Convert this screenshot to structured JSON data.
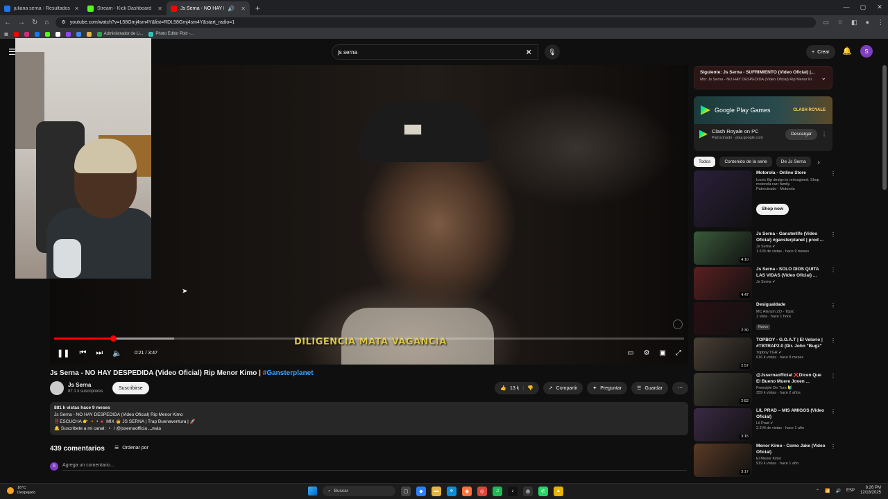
{
  "browser": {
    "tabs": [
      {
        "title": "juliana serna - Resultados de b",
        "favicon_color": "#1877f2",
        "active": false
      },
      {
        "title": "Stream - Kick Dashboard",
        "favicon_color": "#53fc18",
        "active": false
      },
      {
        "title": "Js Serna - NO HAY DESPEDI",
        "favicon_color": "#ff0000",
        "active": true
      }
    ],
    "url": "youtube.com/watch?v=L58Gmj4sm4Y&list=RDL58Gmj4sm4Y&start_radio=1",
    "bookmarks": [
      "Administrador de Li...",
      "Photo Editor Pixlr -..."
    ]
  },
  "yt_header": {
    "search_value": "js serna",
    "create_label": "Crear",
    "avatar_letter": "S"
  },
  "player": {
    "subtitle": "DILIGENCIA MATA VAGANCIA",
    "time": "0:21 / 3:47",
    "progress_fraction": 0.094,
    "buffered_fraction": 0.19
  },
  "video": {
    "title": "Js Serna - NO HAY DESPEDIDA (Video Oficial) Rip Menor Kimo | ",
    "hashtag": "#Gansterplanet",
    "channel": "Js Serna",
    "subscribers": "87.1 k suscriptores",
    "subscribe_label": "Suscribirse",
    "likes": "13 k",
    "share_label": "Compartir",
    "ask_label": "Preguntar",
    "save_label": "Guardar",
    "desc_meta": "881 k vistas  hace 9 meses",
    "desc_line1": "Js Serna - NO HAY DESPEDIDA (Video Oficial) Rip Menor Kimo",
    "desc_line2": "‼️ESCUCHA 👉 🔸 • 🔺 MIX 👨 JS SERNA | Trap Buenaventura | 🚀",
    "desc_line3": "🔔 Suscríbete a mi canal: 🔸 / @jssernaofficia",
    "desc_more": "...más",
    "comments_count": "439 comentarios",
    "sort_label": "Ordenar por",
    "comment_placeholder": "Agrega un comentario..."
  },
  "sidebar": {
    "upnext_title": "Siguiente: Js Serna - SUFRIMIENTO (Video Oficial) |...",
    "upnext_sub": "Mix: Js Serna - NO HAY DESPEDIDA (Video Oficial) Rip Menor Ki",
    "ad": {
      "banner_text": "Google Play Games",
      "banner_brand": "CLASH ROYALE",
      "name": "Clash Royale on PC",
      "sponsor": "Patrocinado · play.google.com",
      "download_label": "Descargar"
    },
    "chips": [
      "Todos",
      "Contenido de la serie",
      "De Js Serna"
    ],
    "recs": [
      {
        "title": "Motorola - Online Store",
        "channel": "Iconic flip design is reimagined. Shop motorola razr family.",
        "meta": "Patrocinado · Motorola",
        "duration": "",
        "badge": "",
        "cta": "Shop now",
        "thumb": "#2a1f3a"
      },
      {
        "title": "Js Serna - Gansterlife (Video Oficial) #gansterplanet | prod ...",
        "channel": "Js Serna ✔",
        "meta": "1.6 M de vistas · hace 9 meses",
        "duration": "4:10",
        "badge": "",
        "cta": "",
        "thumb": "#3a5a3a"
      },
      {
        "title": "Js Serna - SOLO DIOS QUITA LAS VIDAS (Video Oficial) ...",
        "channel": "Js Serna ✔",
        "meta": "",
        "duration": "4:47",
        "badge": "",
        "cta": "",
        "thumb": "#5a1f1f"
      },
      {
        "title": "Desigualdade",
        "channel": "MC Alanzin ZO - Topic",
        "meta": "1 vista · hace 1 hora",
        "duration": "2:30",
        "badge": "Nuevo",
        "cta": "",
        "thumb": "#2a0f14"
      },
      {
        "title": "TOPBOY - G.O.A.T | El Velorio | #TBTRAP2.0 (Dir. John \"Bugz\" ...",
        "channel": "Topboy TGR ✔",
        "meta": "616 k vistas · hace 8 meses",
        "duration": "2:57",
        "badge": "",
        "cta": "",
        "thumb": "#4a4035"
      },
      {
        "title": "@Jssernaofficial ❌Dicen Que El Bueno Muere Joven ...",
        "channel": "Freestyle De Tura 🔰",
        "meta": "359 k vistas · hace 2 años",
        "duration": "2:52",
        "badge": "",
        "cta": "",
        "thumb": "#3c3a30"
      },
      {
        "title": "LIL PRAD – MIS AMIGOS (Video Oficial)",
        "channel": "Lil Prad ✔",
        "meta": "2.3 M de vistas · hace 1 año",
        "duration": "3:15",
        "badge": "",
        "cta": "",
        "thumb": "#3a2a45"
      },
      {
        "title": "Menor Kimo - Como Jake (Video Oficial)",
        "channel": "El Menor Kimo",
        "meta": "919 k vistas · hace 1 año",
        "duration": "3:17",
        "badge": "",
        "cta": "",
        "thumb": "#5a3a25"
      }
    ]
  },
  "taskbar": {
    "weather_temp": "16°C",
    "weather_desc": "Despejado",
    "search_label": "Buscar",
    "lang": "ESP",
    "time": "8:26 PM",
    "date": "12/18/2025"
  }
}
